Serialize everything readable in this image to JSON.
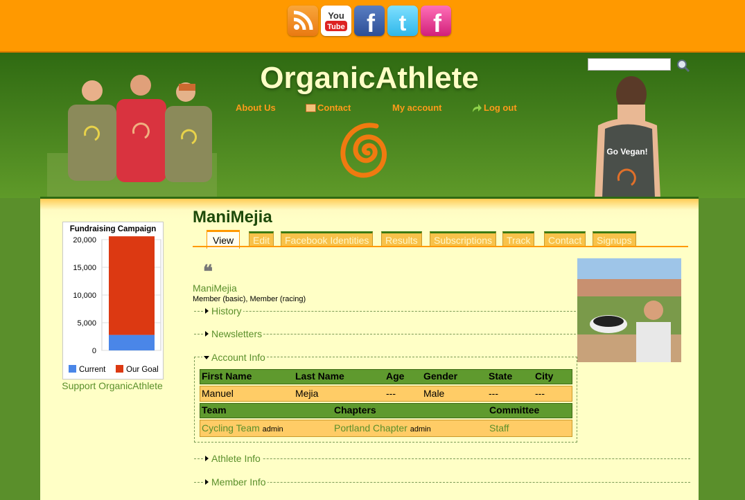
{
  "social": [
    {
      "name": "rss-icon",
      "color": "#f08a24"
    },
    {
      "name": "youtube-icon",
      "label": "You Tube"
    },
    {
      "name": "facebook-icon",
      "color": "#3b5998"
    },
    {
      "name": "twitter-icon",
      "color": "#33ccff"
    },
    {
      "name": "facebook-pink-icon",
      "color": "#e22f8a"
    }
  ],
  "site": {
    "title": "OrganicAthlete"
  },
  "nav": {
    "about": "About Us",
    "contact": "Contact",
    "account": "My account",
    "logout": "Log out"
  },
  "search": {
    "placeholder": ""
  },
  "widget": {
    "title": "Fundraising Campaign",
    "support": "Support OrganicAthlete"
  },
  "chart_data": {
    "type": "bar",
    "title": "Fundraising Campaign",
    "categories": [
      ""
    ],
    "series": [
      {
        "name": "Current",
        "values": [
          2800
        ],
        "color": "#4a86e8"
      },
      {
        "name": "Our Goal",
        "values": [
          17800
        ],
        "color": "#dc3912"
      }
    ],
    "stacked": true,
    "ylim": [
      0,
      20000
    ],
    "yticks": [
      "20,000",
      "15,000",
      "10,000",
      "5,000",
      "0"
    ],
    "legend": "bottom"
  },
  "profile": {
    "title": "ManiMejia",
    "name": "ManiMejia",
    "membership": "Member (basic), Member (racing)"
  },
  "tabs": [
    "View",
    "Edit",
    "Facebook Identities",
    "Results",
    "Subscriptions",
    "Track",
    "Contact",
    "Signups"
  ],
  "sections": {
    "history": "History",
    "newsletters": "Newsletters",
    "account": "Account Info",
    "athlete": "Athlete Info",
    "member": "Member Info"
  },
  "account_table": {
    "headers": [
      "First Name",
      "Last Name",
      "Age",
      "Gender",
      "State",
      "City"
    ],
    "row": [
      "Manuel",
      "Mejia",
      "---",
      "Male",
      "---",
      "---"
    ]
  },
  "team_table": {
    "headers": [
      "Team",
      "Chapters",
      "Committee"
    ],
    "team": "Cycling Team",
    "team_role": "admin",
    "chapter": "Portland Chapter",
    "chapter_role": "admin",
    "committee": "Staff"
  }
}
